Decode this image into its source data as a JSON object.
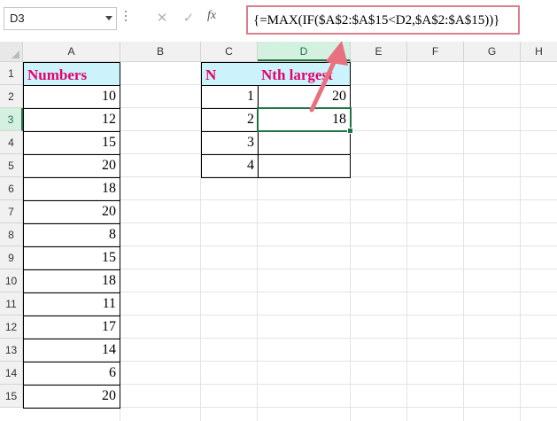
{
  "formula_bar": {
    "name_box": "D3",
    "cancel_icon": "close-icon",
    "enter_icon": "check-icon",
    "fx_label": "fx",
    "formula": "{=MAX(IF($A$2:$A$15<D2,$A$2:$A$15))}"
  },
  "columns": [
    "A",
    "B",
    "C",
    "D",
    "E",
    "F",
    "G",
    "H"
  ],
  "rows": [
    "1",
    "2",
    "3",
    "4",
    "5",
    "6",
    "7",
    "8",
    "9",
    "10",
    "11",
    "12",
    "13",
    "14",
    "15"
  ],
  "selected_column": "D",
  "selected_row": "3",
  "cells": {
    "A1": "Numbers",
    "A2": "10",
    "A3": "12",
    "A4": "15",
    "A5": "20",
    "A6": "18",
    "A7": "20",
    "A8": "8",
    "A9": "15",
    "A10": "18",
    "A11": "11",
    "A12": "17",
    "A13": "14",
    "A14": "6",
    "A15": "20",
    "C1": "N",
    "C2": "1",
    "C3": "2",
    "C4": "3",
    "C5": "4",
    "D1": "Nth largest",
    "D2": "20",
    "D3": "18",
    "D4": "",
    "D5": ""
  },
  "colors": {
    "header_fill": "#ccf2fb",
    "header_text": "#e6006b",
    "selection": "#217346",
    "annotation_arrow": "#e8707f"
  }
}
